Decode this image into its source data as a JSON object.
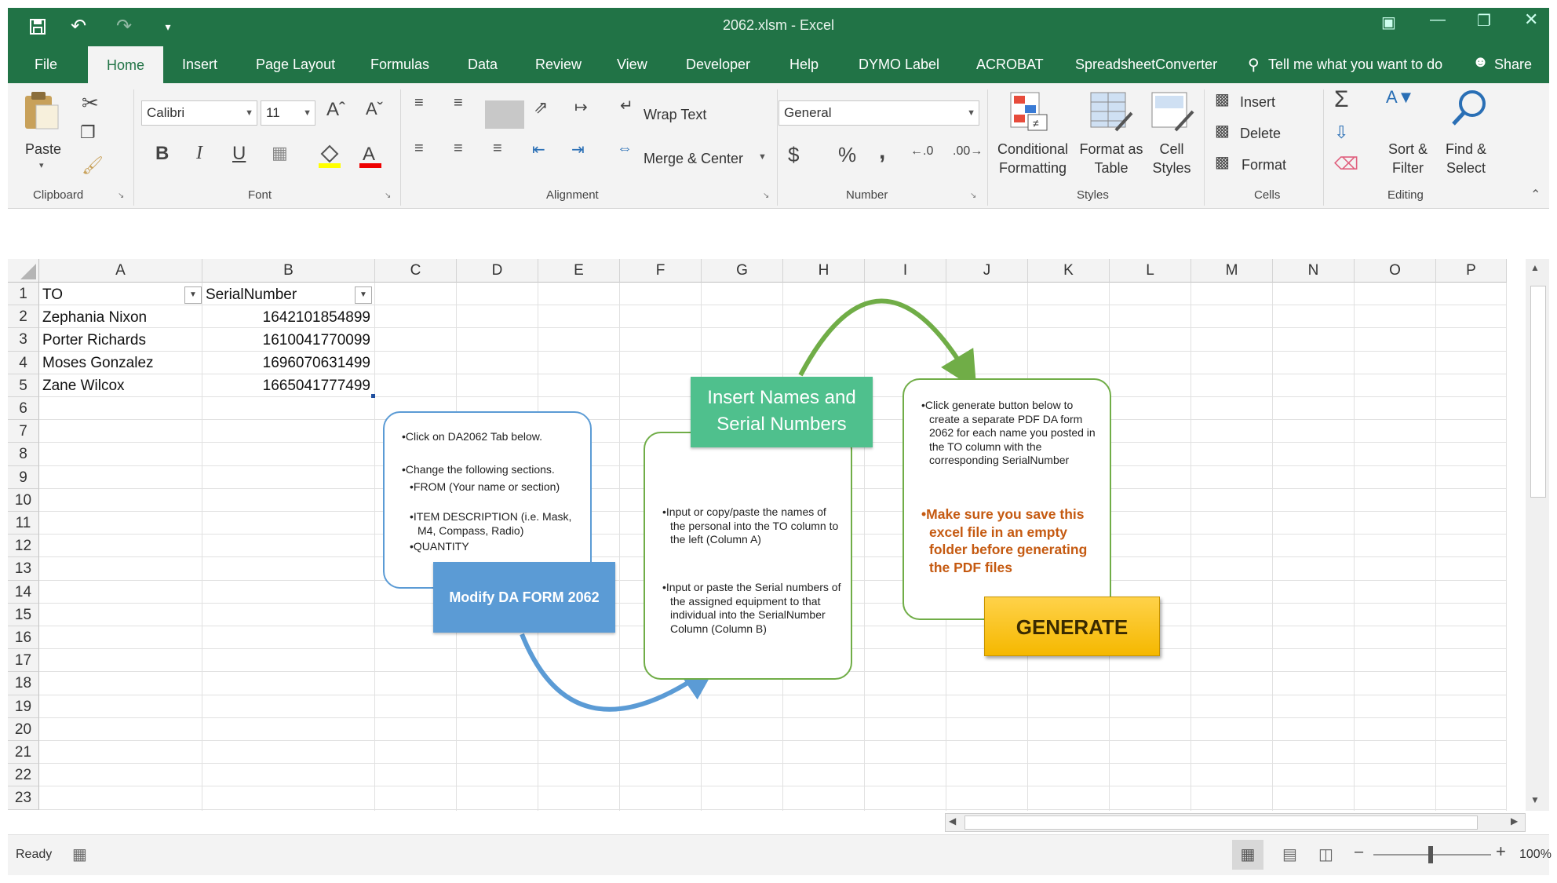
{
  "window": {
    "title": "2062.xlsm  -  Excel"
  },
  "qat": {
    "save_icon": "save-icon",
    "undo_icon": "undo-icon",
    "redo_icon": "redo-icon",
    "customize_icon": "customize-qat-icon"
  },
  "tabs": [
    {
      "label": "File"
    },
    {
      "label": "Home"
    },
    {
      "label": "Insert"
    },
    {
      "label": "Page Layout"
    },
    {
      "label": "Formulas"
    },
    {
      "label": "Data"
    },
    {
      "label": "Review"
    },
    {
      "label": "View"
    },
    {
      "label": "Developer"
    },
    {
      "label": "Help"
    },
    {
      "label": "DYMO Label"
    },
    {
      "label": "ACROBAT"
    },
    {
      "label": "SpreadsheetConverter"
    }
  ],
  "tell_me": "Tell me what you want to do",
  "share": "Share",
  "ribbon": {
    "clipboard": {
      "paste": "Paste",
      "group": "Clipboard"
    },
    "font": {
      "name": "Calibri",
      "size": "11",
      "bold": "B",
      "italic": "I",
      "underline": "U",
      "group": "Font"
    },
    "alignment": {
      "wrap_text": "Wrap Text",
      "merge_center": "Merge & Center",
      "group": "Alignment"
    },
    "number": {
      "format": "General",
      "currency": "$",
      "percent": "%",
      "comma": ",",
      "group": "Number"
    },
    "styles": {
      "conditional": [
        "Conditional",
        "Formatting"
      ],
      "format_table": [
        "Format as",
        "Table"
      ],
      "cell_styles": [
        "Cell",
        "Styles"
      ],
      "group": "Styles"
    },
    "cells": {
      "insert": "Insert",
      "delete": "Delete",
      "format": "Format",
      "group": "Cells"
    },
    "editing": {
      "sort": [
        "Sort &",
        "Filter"
      ],
      "find": [
        "Find &",
        "Select"
      ],
      "group": "Editing"
    }
  },
  "sheet": {
    "columns": [
      "A",
      "B",
      "C",
      "D",
      "E",
      "F",
      "G",
      "H",
      "I",
      "J",
      "K",
      "L",
      "M",
      "N",
      "O",
      "P"
    ],
    "rows": [
      "1",
      "2",
      "3",
      "4",
      "5",
      "6",
      "7",
      "8",
      "9",
      "10",
      "11",
      "12",
      "13",
      "14",
      "15",
      "16",
      "17",
      "18",
      "19",
      "20",
      "21",
      "22",
      "23"
    ],
    "headers": [
      "TO",
      "SerialNumber"
    ],
    "data": [
      [
        "Zephania Nixon",
        "1642101854899"
      ],
      [
        "Porter Richards",
        "1610041770099"
      ],
      [
        "Moses Gonzalez",
        "1696070631499"
      ],
      [
        "Zane Wilcox",
        "1665041777499"
      ]
    ]
  },
  "diagram": {
    "step1": {
      "button": "Modify DA FORM 2062",
      "lines": [
        "Click on DA2062 Tab below.",
        "Change the following sections."
      ],
      "sub": [
        "FROM (Your name or section)",
        "ITEM DESCRIPTION (i.e. Mask, M4, Compass, Radio)",
        "QUANTITY"
      ]
    },
    "step2": {
      "title": "Insert Names and Serial Numbers",
      "lines": [
        "Input or copy/paste the names of the personal into the TO column to the left (Column A)",
        "Input or paste the Serial numbers of the assigned equipment to that individual into the SerialNumber Column (Column B)"
      ]
    },
    "step3": {
      "line": "Click generate button below to create a separate PDF DA form 2062 for each name you posted in the TO column with the corresponding SerialNumber",
      "warning": "Make sure you save this excel file in an empty folder before generating the PDF files",
      "button": "GENERATE"
    },
    "colors": {
      "blue": "#5b9bd5",
      "green": "#70ad47",
      "teal": "#4fc08d",
      "gold": "#f5b800",
      "orange": "#c55a11"
    }
  },
  "status": {
    "ready": "Ready",
    "zoom": "100%"
  }
}
